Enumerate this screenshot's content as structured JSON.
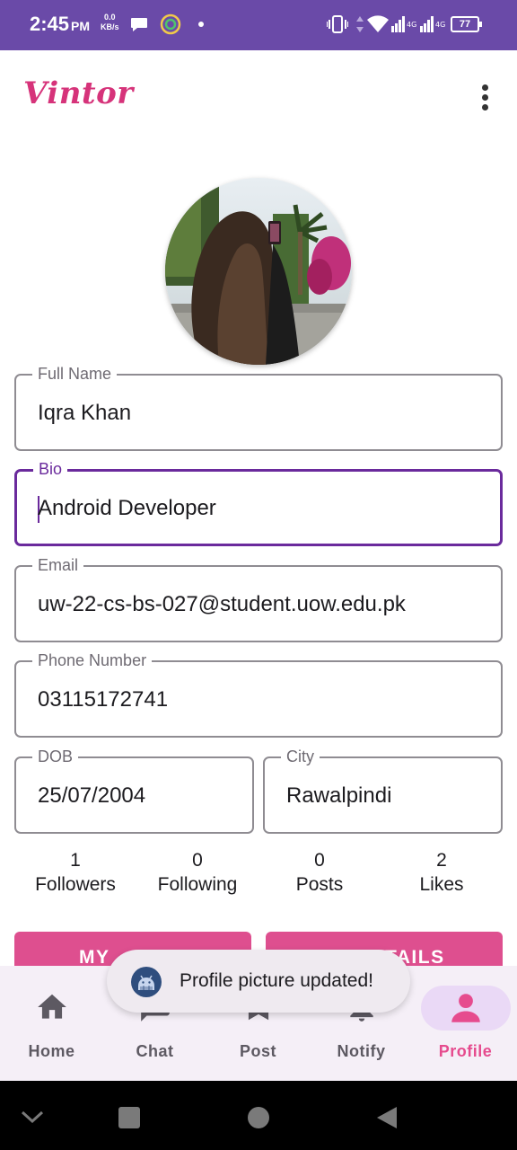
{
  "status_bar": {
    "time": "2:45",
    "ampm": "PM",
    "speed_value": "0.0",
    "speed_unit": "KB/s",
    "battery": "77",
    "icons": [
      "chat-bubble-icon",
      "circle-app-icon",
      "dot-icon",
      "vibrate-icon",
      "data-arrows-icon",
      "wifi-icon",
      "signal-4g-icon",
      "signal-4g-icon",
      "battery-icon"
    ]
  },
  "app_bar": {
    "title": "Vintor",
    "menu_icon": "more-vert-icon"
  },
  "profile": {
    "fields": {
      "full_name": {
        "label": "Full Name",
        "value": "Iqra Khan"
      },
      "bio": {
        "label": "Bio",
        "value": "Android Developer"
      },
      "email": {
        "label": "Email",
        "value": "uw-22-cs-bs-027@student.uow.edu.pk"
      },
      "phone": {
        "label": "Phone Number",
        "value": "03115172741"
      },
      "dob": {
        "label": "DOB",
        "value": "25/07/2004"
      },
      "city": {
        "label": "City",
        "value": "Rawalpindi"
      }
    },
    "stats": [
      {
        "value": "1",
        "label": "Followers"
      },
      {
        "value": "0",
        "label": "Following"
      },
      {
        "value": "0",
        "label": "Posts"
      },
      {
        "value": "2",
        "label": "Likes"
      }
    ],
    "buttons": {
      "left_label": "MY",
      "right_label": "TAILS"
    }
  },
  "toast": {
    "message": "Profile picture updated!",
    "icon": "android-icon"
  },
  "bottom_nav": {
    "items": [
      {
        "label": "Home",
        "icon": "home-icon"
      },
      {
        "label": "Chat",
        "icon": "chat-icon"
      },
      {
        "label": "Post",
        "icon": "post-icon"
      },
      {
        "label": "Notify",
        "icon": "bell-icon"
      },
      {
        "label": "Profile",
        "icon": "person-icon",
        "active": true
      }
    ]
  },
  "system_nav": {
    "icons": [
      "chevron-down-icon",
      "recents-icon",
      "home-circle-icon",
      "back-icon"
    ]
  },
  "colors": {
    "status_bar": "#6a4aa8",
    "brand": "#d6337a",
    "focus": "#6a2a9c",
    "button": "#de4f8f",
    "nav_bg": "#f5eff7",
    "nav_active_pill": "#ead9f6"
  }
}
